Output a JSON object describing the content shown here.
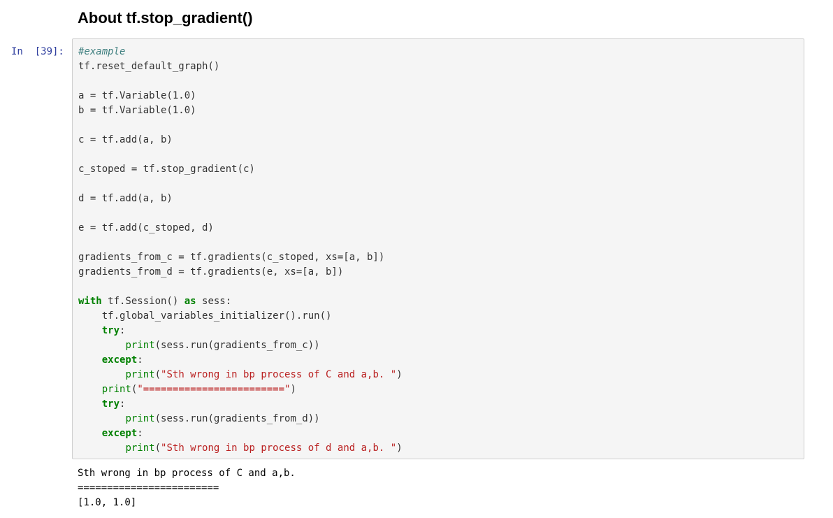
{
  "notebook": {
    "heading": "About tf.stop_gradient()",
    "cell": {
      "prompt": "In  [39]:",
      "code_lines": [
        [
          {
            "t": "cm",
            "v": "#example"
          }
        ],
        [
          {
            "t": "plain",
            "v": "tf.reset_default_graph()"
          }
        ],
        [],
        [
          {
            "t": "plain",
            "v": "a = tf.Variable(1.0)"
          }
        ],
        [
          {
            "t": "plain",
            "v": "b = tf.Variable(1.0)"
          }
        ],
        [],
        [
          {
            "t": "plain",
            "v": "c = tf.add(a, b)"
          }
        ],
        [],
        [
          {
            "t": "plain",
            "v": "c_stoped = tf.stop_gradient(c)"
          }
        ],
        [],
        [
          {
            "t": "plain",
            "v": "d = tf.add(a, b)"
          }
        ],
        [],
        [
          {
            "t": "plain",
            "v": "e = tf.add(c_stoped, d)"
          }
        ],
        [],
        [
          {
            "t": "plain",
            "v": "gradients_from_c = tf.gradients(c_stoped, xs=[a, b])"
          }
        ],
        [
          {
            "t": "plain",
            "v": "gradients_from_d = tf.gradients(e, xs=[a, b])"
          }
        ],
        [],
        [
          {
            "t": "kw",
            "v": "with"
          },
          {
            "t": "plain",
            "v": " tf.Session() "
          },
          {
            "t": "kw",
            "v": "as"
          },
          {
            "t": "plain",
            "v": " sess:"
          }
        ],
        [
          {
            "t": "plain",
            "v": "    tf.global_variables_initializer().run()"
          }
        ],
        [
          {
            "t": "plain",
            "v": "    "
          },
          {
            "t": "kw",
            "v": "try"
          },
          {
            "t": "plain",
            "v": ":"
          }
        ],
        [
          {
            "t": "plain",
            "v": "        "
          },
          {
            "t": "builtin",
            "v": "print"
          },
          {
            "t": "plain",
            "v": "(sess.run(gradients_from_c))"
          }
        ],
        [
          {
            "t": "plain",
            "v": "    "
          },
          {
            "t": "kw",
            "v": "except"
          },
          {
            "t": "plain",
            "v": ":"
          }
        ],
        [
          {
            "t": "plain",
            "v": "        "
          },
          {
            "t": "builtin",
            "v": "print"
          },
          {
            "t": "plain",
            "v": "("
          },
          {
            "t": "str",
            "v": "\"Sth wrong in bp process of C and a,b. \""
          },
          {
            "t": "plain",
            "v": ")"
          }
        ],
        [
          {
            "t": "plain",
            "v": "    "
          },
          {
            "t": "builtin",
            "v": "print"
          },
          {
            "t": "plain",
            "v": "("
          },
          {
            "t": "str",
            "v": "\"========================\""
          },
          {
            "t": "plain",
            "v": ")"
          }
        ],
        [
          {
            "t": "plain",
            "v": "    "
          },
          {
            "t": "kw",
            "v": "try"
          },
          {
            "t": "plain",
            "v": ":"
          }
        ],
        [
          {
            "t": "plain",
            "v": "        "
          },
          {
            "t": "builtin",
            "v": "print"
          },
          {
            "t": "plain",
            "v": "(sess.run(gradients_from_d))"
          }
        ],
        [
          {
            "t": "plain",
            "v": "    "
          },
          {
            "t": "kw",
            "v": "except"
          },
          {
            "t": "plain",
            "v": ":"
          }
        ],
        [
          {
            "t": "plain",
            "v": "        "
          },
          {
            "t": "builtin",
            "v": "print"
          },
          {
            "t": "plain",
            "v": "("
          },
          {
            "t": "str",
            "v": "\"Sth wrong in bp process of d and a,b. \""
          },
          {
            "t": "plain",
            "v": ")"
          }
        ]
      ],
      "output_lines": [
        "Sth wrong in bp process of C and a,b.",
        "========================",
        "[1.0, 1.0]"
      ]
    }
  }
}
